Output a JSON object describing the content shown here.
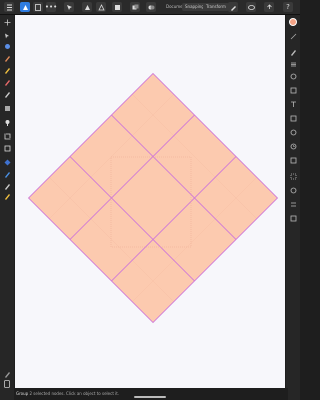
{
  "toolbar": {
    "doc_label": "Document",
    "snapping_label": "Snapping",
    "transform_label": "Transform",
    "icons": [
      "menu-icon",
      "persona-icon",
      "more-icon",
      "boolean-icon",
      "align-icon",
      "arrange-icon",
      "view-icon",
      "layers-icon"
    ]
  },
  "left_tools": [
    "move-tool-icon",
    "node-tool-icon",
    "pen-tool-icon",
    "pencil-tool-icon",
    "brush-tool-icon",
    "fill-tool-icon",
    "gradient-tool-icon",
    "transparency-tool-icon",
    "crop-tool-icon",
    "shape-tool-icon",
    "text-tool-icon",
    "color-picker-icon",
    "zoom-tool-icon",
    "view-tool-icon"
  ],
  "right_panels": [
    "color-panel-icon",
    "stroke-panel-icon",
    "brush-panel-icon",
    "layers-panel-icon",
    "effects-panel-icon",
    "styles-panel-icon",
    "text-styles-panel-icon",
    "stock-panel-icon",
    "transform-panel-icon",
    "history-panel-icon",
    "navigator-panel-icon",
    "symbols-panel-icon",
    "constraints-panel-icon",
    "assets-panel-icon",
    "swatches-panel-icon"
  ],
  "canvas": {
    "fill_color": "#fccaaf",
    "stroke_color": "#d07ad7",
    "grid": "3x3",
    "rotation": "45°"
  },
  "status": {
    "layer_name": "Group",
    "message": "2 selected nodes. Click an object to select it."
  }
}
